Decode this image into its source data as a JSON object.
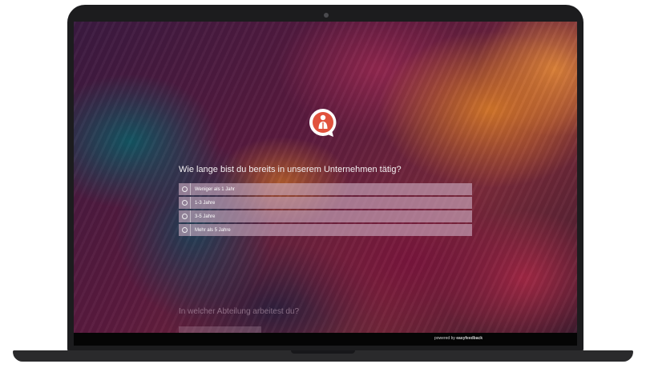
{
  "survey": {
    "question": "Wie lange bist du bereits in unserem Unternehmen tätig?",
    "options": [
      {
        "label": "Weniger als 1 Jahr"
      },
      {
        "label": "1-3 Jahre"
      },
      {
        "label": "3-5 Jahre"
      },
      {
        "label": "Mehr als 5 Jahre"
      }
    ],
    "next_question": "In welcher Abteilung arbeitest du?"
  },
  "footer": {
    "prefix": "powered by",
    "brand": "easyfeedback"
  },
  "icons": {
    "logo": "person-speech-bubble-icon",
    "radio": "radio-circle-icon"
  },
  "colors": {
    "logo_accent": "#e1523d",
    "option_background": "#cdafc3"
  }
}
